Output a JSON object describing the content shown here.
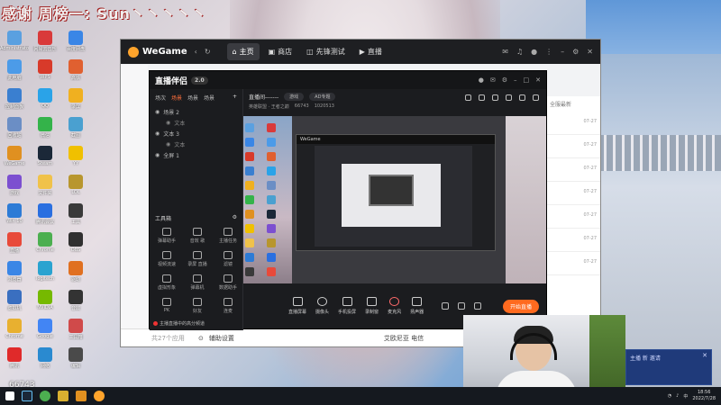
{
  "overlay": {
    "title": "感谢 周榜一: Sun丶丶丶丶丶"
  },
  "desktop": {
    "icons": [
      {
        "label": "Administrator",
        "color": "#5aa0e0"
      },
      {
        "label": "网易云音乐",
        "color": "#d93a3a"
      },
      {
        "label": "百度网盘",
        "color": "#3a86e6"
      },
      {
        "label": "此电脑",
        "color": "#4c9be8"
      },
      {
        "label": "WPS",
        "color": "#d83a2a"
      },
      {
        "label": "高铁",
        "color": "#e06030"
      },
      {
        "label": "控制面板",
        "color": "#3a7fd0"
      },
      {
        "label": "QQ",
        "color": "#2aa3e8"
      },
      {
        "label": "录屏",
        "color": "#f0b020"
      },
      {
        "label": "回收站",
        "color": "#6b8ec5"
      },
      {
        "label": "微信",
        "color": "#34b34a"
      },
      {
        "label": "截图",
        "color": "#4aa0d0"
      },
      {
        "label": "WeGame",
        "color": "#e09020"
      },
      {
        "label": "Steam",
        "color": "#1b2838"
      },
      {
        "label": "YY",
        "color": "#f0c000"
      },
      {
        "label": "游戏",
        "color": "#7c4fd0"
      },
      {
        "label": "文件夹",
        "color": "#f0c24a"
      },
      {
        "label": "LOL",
        "color": "#b8962e"
      },
      {
        "label": "Win 10",
        "color": "#2d7bd6"
      },
      {
        "label": "腾讯会议",
        "color": "#2a6fe0"
      },
      {
        "label": "工具",
        "color": "#3a3a3a"
      },
      {
        "label": "直播",
        "color": "#e84a3a"
      },
      {
        "label": "Chrome",
        "color": "#4caf50"
      },
      {
        "label": "OBS",
        "color": "#303030"
      },
      {
        "label": "浏览器",
        "color": "#3a86e6"
      },
      {
        "label": "logitech",
        "color": "#2aa3d0"
      },
      {
        "label": "驱动",
        "color": "#e07020"
      },
      {
        "label": "虚拟机",
        "color": "#3a6fc0"
      },
      {
        "label": "NVIDIA",
        "color": "#76b900"
      },
      {
        "label": "音效",
        "color": "#333333"
      },
      {
        "label": "Chrome",
        "color": "#e8b030"
      },
      {
        "label": "Google",
        "color": "#4285f4"
      },
      {
        "label": "工具箱",
        "color": "#d04a4a"
      },
      {
        "label": "腾讯",
        "color": "#e02a2a"
      },
      {
        "label": "网络",
        "color": "#2a8ad0"
      },
      {
        "label": "编辑",
        "color": "#4a4a4a"
      }
    ],
    "count": "66743"
  },
  "wegame": {
    "logo": "WeGame",
    "nav": [
      "主页",
      "商店",
      "先锋测试",
      "直播"
    ],
    "right_header": "全服最新",
    "dates": [
      "07-27",
      "07-27",
      "07-27",
      "07-27",
      "07-27",
      "07-27",
      "07-27"
    ],
    "bottom_left": "共27个应用",
    "bottom_label": "辅助设置",
    "bottom_status": "艾欧尼亚 电信"
  },
  "streamer": {
    "logo": "直播伴侣",
    "version": "2.0",
    "scene_tabs": [
      "场次",
      "场景",
      "场景",
      "场景"
    ],
    "scenes": [
      {
        "label": "场景 2",
        "sub": false
      },
      {
        "label": "文本",
        "sub": true
      },
      {
        "label": "文本 3",
        "sub": false
      },
      {
        "label": "文本",
        "sub": true
      },
      {
        "label": "全屏 1",
        "sub": false
      }
    ],
    "tools_title": "工具箱",
    "tools": [
      "弹幕助手",
      "音效 歌",
      "主播任务",
      "视频流速",
      "录屏 直播",
      "滤镜",
      "虚拟形象",
      "弹幕机",
      "数据助手",
      "PK",
      "好友",
      "连麦"
    ],
    "notice": "主播直播中的高分频道",
    "stream_title": "直播间-------",
    "category": "游戏",
    "ad_label": "AD专题",
    "meta": [
      "英雄联盟 · 王者之巅",
      "66743",
      "1020513"
    ],
    "controls": [
      "直播屏幕",
      "摄像头",
      "手机投屏",
      "录制窗",
      "麦克风",
      "扬声器"
    ],
    "start_button": "开始直播"
  },
  "notification": {
    "text": "主播 新 邀请"
  },
  "taskbar": {
    "time": "18:56",
    "date": "2022/7/28"
  }
}
